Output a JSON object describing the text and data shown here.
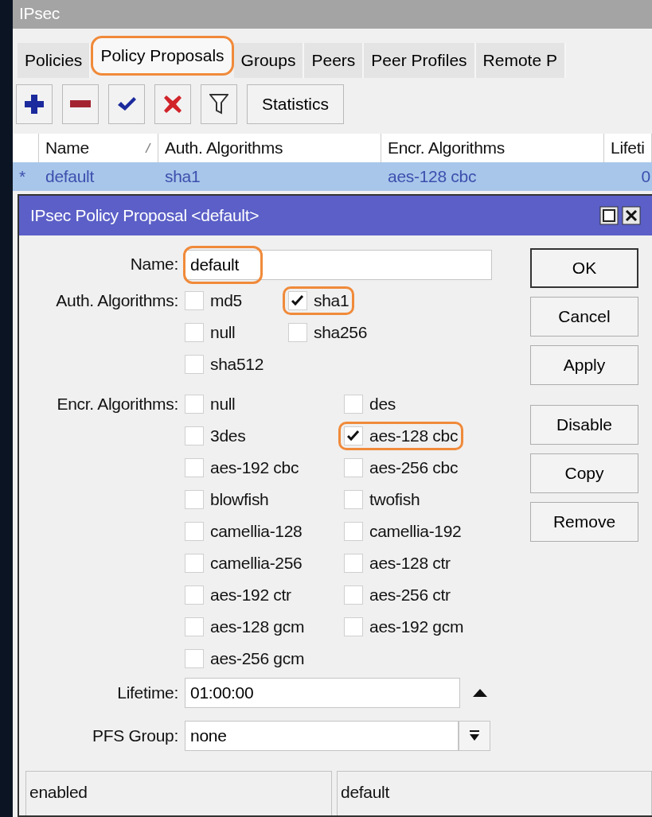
{
  "window": {
    "title": "IPsec"
  },
  "tabs": [
    {
      "label": "Policies",
      "selected": false,
      "highlighted": false
    },
    {
      "label": "Policy Proposals",
      "selected": true,
      "highlighted": true
    },
    {
      "label": "Groups",
      "selected": false,
      "highlighted": false
    },
    {
      "label": "Peers",
      "selected": false,
      "highlighted": false
    },
    {
      "label": "Peer Profiles",
      "selected": false,
      "highlighted": false
    },
    {
      "label": "Remote P",
      "selected": false,
      "highlighted": false
    }
  ],
  "toolbar": [
    {
      "kind": "add"
    },
    {
      "kind": "remove"
    },
    {
      "kind": "enable"
    },
    {
      "kind": "disable"
    },
    {
      "kind": "filter"
    },
    {
      "kind": "text",
      "label": "Statistics"
    }
  ],
  "table": {
    "columns": [
      {
        "label": "Name",
        "sorted": true
      },
      {
        "label": "Auth. Algorithms",
        "sorted": false
      },
      {
        "label": "Encr. Algorithms",
        "sorted": false
      },
      {
        "label": "Lifeti",
        "sorted": false
      }
    ],
    "rows": [
      {
        "marker": "*",
        "selected": true,
        "cells": [
          "default",
          "sha1",
          "aes-128 cbc",
          "0"
        ]
      }
    ]
  },
  "dialog": {
    "title": "IPsec Policy Proposal <default>",
    "name": {
      "label": "Name:",
      "value": "default",
      "highlighted": true
    },
    "checkbox_groups": [
      {
        "label": "Auth. Algorithms:",
        "options": [
          {
            "label": "md5",
            "checked": false,
            "highlighted": false
          },
          {
            "label": "sha1",
            "checked": true,
            "highlighted": true
          },
          {
            "label": "null",
            "checked": false,
            "highlighted": false
          },
          {
            "label": "sha256",
            "checked": false,
            "highlighted": false
          },
          {
            "label": "sha512",
            "checked": false,
            "highlighted": false
          }
        ]
      },
      {
        "label": "Encr. Algorithms:",
        "options": [
          {
            "label": "null",
            "checked": false,
            "highlighted": false
          },
          {
            "label": "des",
            "checked": false,
            "highlighted": false
          },
          {
            "label": "3des",
            "checked": false,
            "highlighted": false
          },
          {
            "label": "aes-128 cbc",
            "checked": true,
            "highlighted": true
          },
          {
            "label": "aes-192 cbc",
            "checked": false,
            "highlighted": false
          },
          {
            "label": "aes-256 cbc",
            "checked": false,
            "highlighted": false
          },
          {
            "label": "blowfish",
            "checked": false,
            "highlighted": false
          },
          {
            "label": "twofish",
            "checked": false,
            "highlighted": false
          },
          {
            "label": "camellia-128",
            "checked": false,
            "highlighted": false
          },
          {
            "label": "camellia-192",
            "checked": false,
            "highlighted": false
          },
          {
            "label": "camellia-256",
            "checked": false,
            "highlighted": false
          },
          {
            "label": "aes-128 ctr",
            "checked": false,
            "highlighted": false
          },
          {
            "label": "aes-192 ctr",
            "checked": false,
            "highlighted": false
          },
          {
            "label": "aes-256 ctr",
            "checked": false,
            "highlighted": false
          },
          {
            "label": "aes-128 gcm",
            "checked": false,
            "highlighted": false
          },
          {
            "label": "aes-192 gcm",
            "checked": false,
            "highlighted": false
          },
          {
            "label": "aes-256 gcm",
            "checked": false,
            "highlighted": false
          }
        ]
      }
    ],
    "lifetime": {
      "label": "Lifetime:",
      "value": "01:00:00"
    },
    "pfs_group": {
      "label": "PFS Group:",
      "value": "none"
    },
    "buttons": [
      {
        "label": "OK",
        "default": true
      },
      {
        "label": "Cancel",
        "default": false
      },
      {
        "label": "Apply",
        "default": false
      },
      {
        "label": "Disable",
        "default": false
      },
      {
        "label": "Copy",
        "default": false
      },
      {
        "label": "Remove",
        "default": false
      }
    ],
    "status_bar": [
      "enabled",
      "default"
    ]
  }
}
